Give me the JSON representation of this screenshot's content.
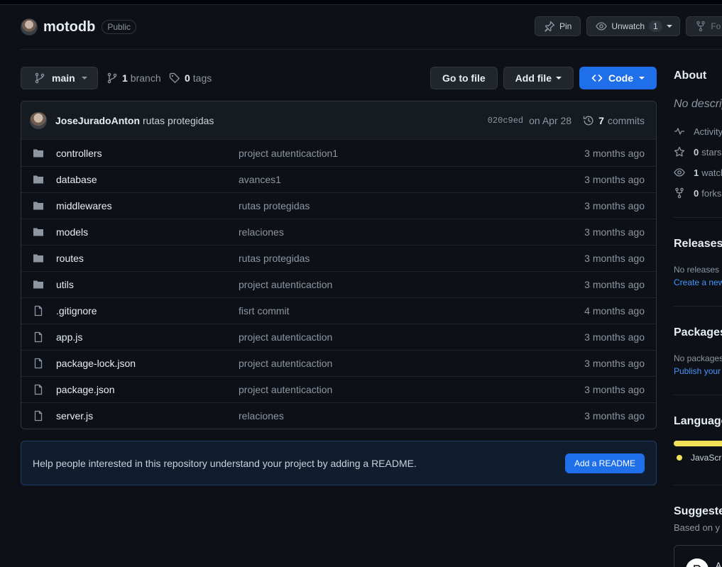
{
  "repo": {
    "name": "motodb",
    "visibility": "Public"
  },
  "header_actions": {
    "pin_label": "Pin",
    "unwatch_label": "Unwatch",
    "watch_count": "1",
    "fork_label": "Fo"
  },
  "toolbar": {
    "branch": "main",
    "branch_count": "1",
    "branch_word": "branch",
    "tag_count": "0",
    "tag_word": "tags",
    "go_to_file": "Go to file",
    "add_file": "Add file",
    "code": "Code"
  },
  "commit": {
    "author": "JoseJuradoAnton",
    "message": "rutas protegidas",
    "sha": "020c9ed",
    "date": "on Apr 28",
    "count": "7",
    "count_word": "commits"
  },
  "files": [
    {
      "type": "folder",
      "name": "controllers",
      "message": "project autenticaction1",
      "age": "3 months ago"
    },
    {
      "type": "folder",
      "name": "database",
      "message": "avances1",
      "age": "3 months ago"
    },
    {
      "type": "folder",
      "name": "middlewares",
      "message": "rutas protegidas",
      "age": "3 months ago"
    },
    {
      "type": "folder",
      "name": "models",
      "message": "relaciones",
      "age": "3 months ago"
    },
    {
      "type": "folder",
      "name": "routes",
      "message": "rutas protegidas",
      "age": "3 months ago"
    },
    {
      "type": "folder",
      "name": "utils",
      "message": "project autenticaction",
      "age": "3 months ago"
    },
    {
      "type": "file",
      "name": ".gitignore",
      "message": "fisrt commit",
      "age": "4 months ago"
    },
    {
      "type": "file",
      "name": "app.js",
      "message": "project autenticaction",
      "age": "3 months ago"
    },
    {
      "type": "file",
      "name": "package-lock.json",
      "message": "project autenticaction",
      "age": "3 months ago"
    },
    {
      "type": "file",
      "name": "package.json",
      "message": "project autenticaction",
      "age": "3 months ago"
    },
    {
      "type": "file",
      "name": "server.js",
      "message": "relaciones",
      "age": "3 months ago"
    }
  ],
  "readme_banner": {
    "text": "Help people interested in this repository understand your project by adding a README.",
    "button": "Add a README"
  },
  "sidebar": {
    "about_title": "About",
    "about_desc": "No descrip",
    "activity": "Activity",
    "stars_count": "0",
    "stars_word": "stars",
    "watch_count": "1",
    "watch_word": "watch",
    "forks_count": "0",
    "forks_word": "forks",
    "releases_title": "Releases",
    "releases_text": "No releases p",
    "releases_link": "Create a new",
    "packages_title": "Packages",
    "packages_text": "No packages",
    "packages_link": "Publish your",
    "languages_title": "Language",
    "language_name": "JavaScri",
    "suggested_title": "Suggeste",
    "suggested_sub": "Based on y",
    "suggested_card_text": "A"
  },
  "colors": {
    "background": "#0d1117",
    "border": "#30363d",
    "accent": "#1f6feb",
    "link": "#4493f8",
    "javascript": "#f1e05a"
  }
}
